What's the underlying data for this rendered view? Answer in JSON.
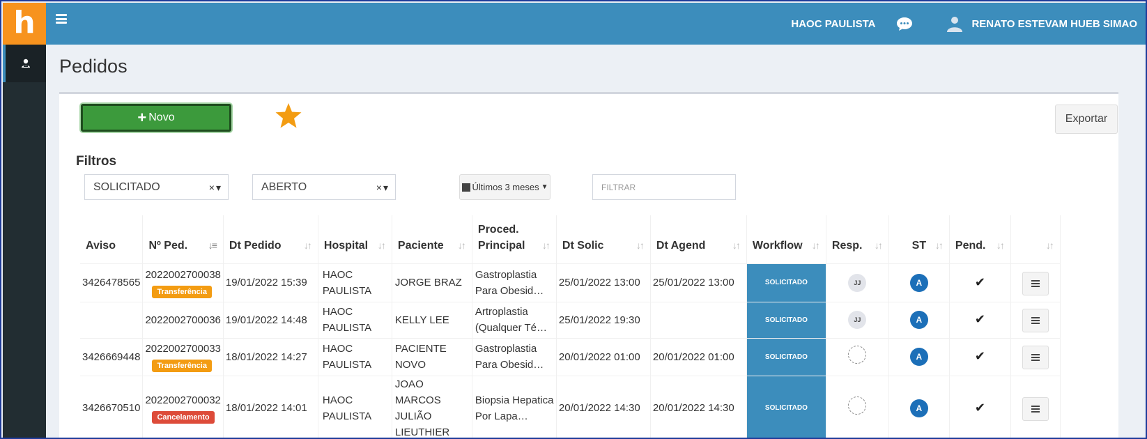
{
  "app": {
    "logo_letter": "h"
  },
  "header": {
    "hospital": "HAOC PAULISTA",
    "user_name": "RENATO ESTEVAM HUEB SIMAO"
  },
  "page": {
    "title": "Pedidos"
  },
  "toolbar": {
    "novo_label": "Novo",
    "exportar_label": "Exportar"
  },
  "filters": {
    "label": "Filtros",
    "status_1": "SOLICITADO",
    "status_2": "ABERTO",
    "date_range": "Últimos 3 meses",
    "search_placeholder": "FILTRAR"
  },
  "table": {
    "columns": [
      "Aviso",
      "Nº Ped.",
      "Dt Pedido",
      "Hospital",
      "Paciente",
      "Proced. Principal",
      "Dt Solic",
      "Dt Agend",
      "Workflow",
      "Resp.",
      "ST",
      "Pend."
    ],
    "rows": [
      {
        "aviso": "3426478565",
        "pedido": "2022002700038",
        "tag": "Transferência",
        "dt_pedido": "19/01/2022 15:39",
        "hospital": "HAOC PAULISTA",
        "paciente": "JORGE BRAZ",
        "procedimento": "Gastroplastia Para Obesid…",
        "dt_solic": "25/01/2022 13:00",
        "dt_agend": "25/01/2022 13:00",
        "workflow": "SOLICITADO",
        "resp": "JJ",
        "st": "A",
        "pend": "✔"
      },
      {
        "aviso": "",
        "pedido": "2022002700036",
        "tag": "",
        "dt_pedido": "19/01/2022 14:48",
        "hospital": "HAOC PAULISTA",
        "paciente": "KELLY LEE",
        "procedimento": "Artroplastia (Qualquer Té…",
        "dt_solic": "25/01/2022 19:30",
        "dt_agend": "",
        "workflow": "SOLICITADO",
        "resp": "JJ",
        "st": "A",
        "pend": "✔"
      },
      {
        "aviso": "3426669448",
        "pedido": "2022002700033",
        "tag": "Transferência",
        "dt_pedido": "18/01/2022 14:27",
        "hospital": "HAOC PAULISTA",
        "paciente": "PACIENTE NOVO",
        "procedimento": "Gastroplastia Para Obesid…",
        "dt_solic": "20/01/2022 01:00",
        "dt_agend": "20/01/2022 01:00",
        "workflow": "SOLICITADO",
        "resp": "",
        "st": "A",
        "pend": "✔"
      },
      {
        "aviso": "3426670510",
        "pedido": "2022002700032",
        "tag": "Cancelamento",
        "dt_pedido": "18/01/2022 14:01",
        "hospital": "HAOC PAULISTA",
        "paciente": "JOAO MARCOS JULIÃO LIEUTHIER",
        "procedimento": "Biopsia Hepatica Por Lapa…",
        "dt_solic": "20/01/2022 14:30",
        "dt_agend": "20/01/2022 14:30",
        "workflow": "SOLICITADO",
        "resp": "",
        "st": "A",
        "pend": "✔"
      }
    ]
  },
  "colors": {
    "header": "#3c8dbc",
    "logo_bg": "#f7931e",
    "sidebar": "#222d32",
    "novo_button": "#3c9a3c",
    "star": "#f39c12",
    "badge_transfer": "#f39c12",
    "badge_cancel": "#dd4b39",
    "st_badge": "#1c6fb8"
  },
  "icons": {
    "menu": "hamburger-icon",
    "chat": "chat-bubble-icon",
    "user": "user-icon",
    "sidebar": "user-card-icon",
    "favorite": "star-icon",
    "calendar": "calendar-icon"
  }
}
